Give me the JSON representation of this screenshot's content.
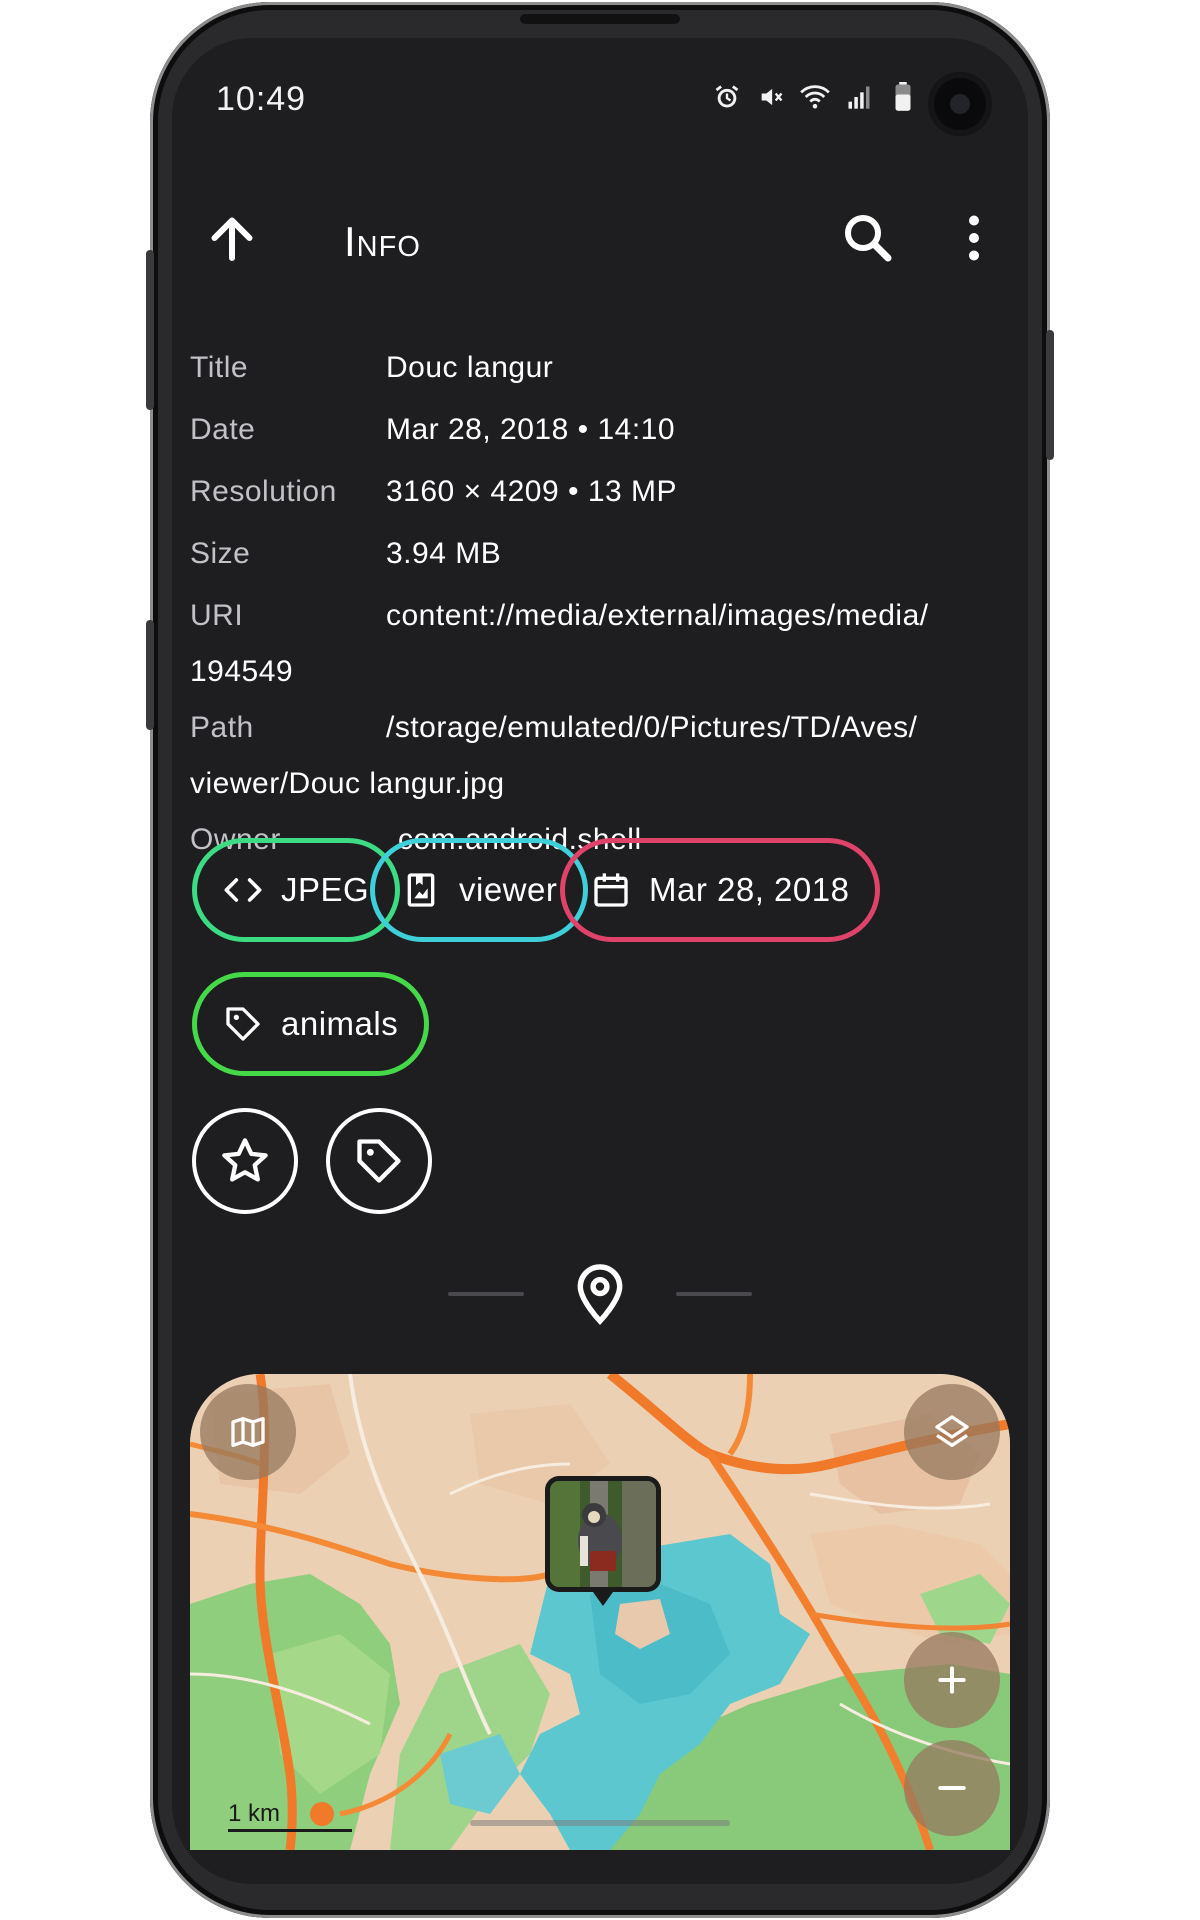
{
  "status_bar": {
    "time": "10:49",
    "icons": [
      "alarm-icon",
      "vibrate-off-icon",
      "wifi-icon",
      "signal-icon",
      "battery-icon"
    ]
  },
  "app_bar": {
    "title": "Info",
    "icons": [
      "arrow-up-icon",
      "search-icon",
      "more-vert-icon"
    ]
  },
  "info": {
    "title_label": "Title",
    "title_value": "Douc langur",
    "date_label": "Date",
    "date_value": "Mar 28, 2018 • 14:10",
    "resolution_label": "Resolution",
    "resolution_value": "3160 × 4209 • 13 MP",
    "size_label": "Size",
    "size_value": "3.94 MB",
    "uri_label": "URI",
    "uri_value_1": "content://media/external/images/media/",
    "uri_value_2": "194549",
    "path_label": "Path",
    "path_value_1": "/storage/emulated/0/Pictures/TD/Aves/",
    "path_value_2": "viewer/Douc langur.jpg",
    "owner_label": "Owner",
    "owner_value": "com.android.shell"
  },
  "chips": {
    "format": {
      "label": "JPEG",
      "icon": "code-icon",
      "color": "#3ddc84"
    },
    "album": {
      "label": "viewer",
      "icon": "album-icon",
      "color": "#3ecfd9"
    },
    "date": {
      "label": "Mar 28, 2018",
      "icon": "calendar-icon",
      "color": "#e0436a"
    },
    "tag": {
      "label": "animals",
      "icon": "tag-icon",
      "color": "#45d94a"
    }
  },
  "actions": [
    "star-icon",
    "tag-icon"
  ],
  "location_section": {
    "icon": "location-pin-icon"
  },
  "map": {
    "scale_label": "1 km",
    "buttons": [
      "map-style-icon",
      "layers-icon",
      "zoom-in-icon",
      "zoom-out-icon"
    ]
  },
  "colors": {
    "background": "#1e1e21",
    "text": "#ffffff",
    "label": "#c2c2c6"
  }
}
